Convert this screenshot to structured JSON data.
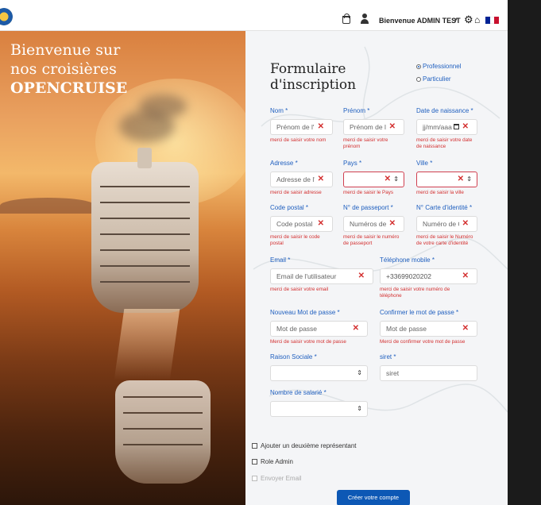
{
  "topbar": {
    "welcome": "Bienvenue ADMIN TEST",
    "caret": "▾",
    "flag_colors": [
      "#c8102e",
      "#ffffff",
      "#002395"
    ]
  },
  "hero": {
    "line1": "Bienvenue sur",
    "line2": "nos croisières",
    "line3": "OPENCRUISE"
  },
  "form": {
    "title_line1": "Formulaire",
    "title_line2": "d'inscription",
    "radio_pro": "Professionnel",
    "radio_part": "Particulier",
    "nom": {
      "label": "Nom *",
      "placeholder": "Prénom de l'u",
      "error": "merci de saisir votre nom"
    },
    "prenom": {
      "label": "Prénom *",
      "placeholder": "Prénom de l'u",
      "error_l1": "merci de saisir votre",
      "error_l2": "prénom"
    },
    "naissance": {
      "label": "Date de naissance *",
      "placeholder": "jj/mm/aaa",
      "error_l1": "merci de saisir votre date",
      "error_l2": "de naissance"
    },
    "adresse": {
      "label": "Adresse *",
      "placeholder": "Adresse de l'u",
      "error": "merci de saisir adresse"
    },
    "pays": {
      "label": "Pays *",
      "error": "merci de saisir le Pays"
    },
    "ville": {
      "label": "Ville *",
      "error": "merci de saisir la ville"
    },
    "code_postal": {
      "label": "Code postal *",
      "placeholder": "Code postal",
      "error_l1": "merci de saisir le code",
      "error_l2": "postal"
    },
    "passeport": {
      "label": "N° de passeport *",
      "placeholder": "Numéros de p",
      "error_l1": "merci de saisir le numéro",
      "error_l2": "de passeport"
    },
    "carte_id": {
      "label": "N° Carte d'identité *",
      "placeholder": "Numéro de C/",
      "error_l1": "merci de saisir le Numéro",
      "error_l2": "de votre carte d'identité"
    },
    "email": {
      "label": "Email *",
      "placeholder": "Email de l'utilisateur",
      "error": "merci de saisir votre email"
    },
    "telephone": {
      "label": "Téléphone mobile *",
      "value": "+33699020202",
      "error_l1": "merci de saisir votre numéro de",
      "error_l2": "téléphone"
    },
    "mdp": {
      "label": "Nouveau Mot de passe *",
      "placeholder": "Mot de passe",
      "error": "Merci de saisir votre mot de passe"
    },
    "mdp_confirm": {
      "label": "Confirmer le mot de passe *",
      "placeholder": "Mot de passe",
      "error": "Merci de confirmer votre mot de passe"
    },
    "raison_sociale": {
      "label": "Raison Sociale *"
    },
    "siret": {
      "label": "siret *",
      "placeholder": "siret"
    },
    "nb_salaries": {
      "label": "Nombre de salarié *"
    },
    "check_representant": "Ajouter un deuxième représentant",
    "check_admin": "Role Admin",
    "check_email": "Envoyer Email",
    "submit": "Créer votre compte"
  }
}
